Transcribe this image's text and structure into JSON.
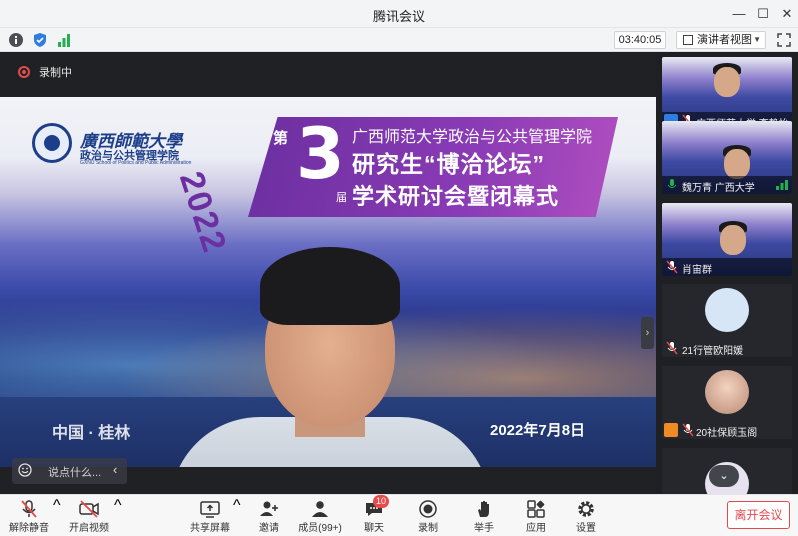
{
  "window": {
    "title": "腾讯会议",
    "minimize": "—",
    "maximize": "☐",
    "close": "✕"
  },
  "info_bar": {
    "timer": "03:40:05",
    "view_label": "演讲者视图",
    "icons": [
      "info-icon",
      "shield-icon",
      "signal-icon",
      "grid-icon",
      "fullscreen-icon"
    ]
  },
  "stage": {
    "recording_label": "录制中",
    "slide": {
      "university": "廣西師範大學",
      "school": "政治与公共管理学院",
      "school_en": "GXNU School of Politics and Public Administration",
      "year": "2022",
      "ordinal_prefix": "第",
      "ordinal_number": "3",
      "ordinal_suffix": "届",
      "institute": "广西师范大学政治与公共管理学院",
      "forum": "研究生“博洽论坛”",
      "closing": "学术研讨会暨闭幕式",
      "place": "中国 · 桂林",
      "date": "2022年7月8日"
    },
    "chat_placeholder": "说点什么...",
    "chat_arrow": "‹",
    "collapse_arrow": "›"
  },
  "participants": [
    {
      "name": "广西师范大学 李静怡"
    },
    {
      "name": "魏万青 广西大学"
    },
    {
      "name": "肖宙群"
    },
    {
      "name": "21行管欧阳媛"
    },
    {
      "name": "20社保顾玉阁"
    }
  ],
  "sidebar": {
    "scroll_down": "⌄"
  },
  "toolbar": {
    "unmute": "解除静音",
    "start_video": "开启视频",
    "share_screen": "共享屏幕",
    "invite": "邀请",
    "members": "成员(99+)",
    "chat": "聊天",
    "chat_badge": "10",
    "record": "录制",
    "raise_hand": "举手",
    "apps": "应用",
    "settings": "设置",
    "leave": "离开会议",
    "caret": "^"
  },
  "colors": {
    "leave_red": "#e5484d",
    "badge_red": "#e84a4a",
    "signal_green": "#22b14c",
    "shield_blue": "#2f7de1"
  }
}
